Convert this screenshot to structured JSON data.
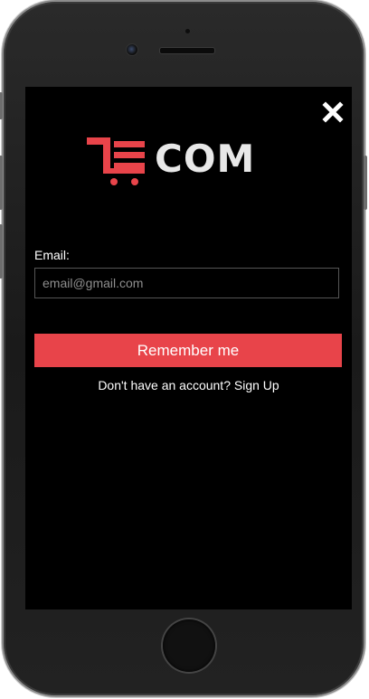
{
  "logo": {
    "text": "COM",
    "accent_color": "#e8444a"
  },
  "close": {
    "icon": "close-icon"
  },
  "form": {
    "email_label": "Email:",
    "email_placeholder": "email@gmail.com",
    "email_value": "",
    "submit_label": "Remember me",
    "signup_prompt": "Don't have an account?",
    "signup_link": "Sign Up"
  },
  "colors": {
    "button": "#e8444a",
    "background": "#000000"
  }
}
